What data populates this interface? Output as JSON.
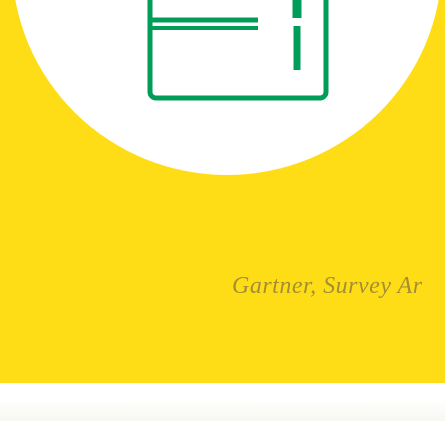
{
  "caption": {
    "text": "Gartner, Survey Ar"
  },
  "icon": {
    "name": "document-card-icon",
    "color": "#009c5a"
  },
  "colors": {
    "background": "#fedd17",
    "circle": "#ffffff",
    "caption": "#8a7a3a"
  }
}
